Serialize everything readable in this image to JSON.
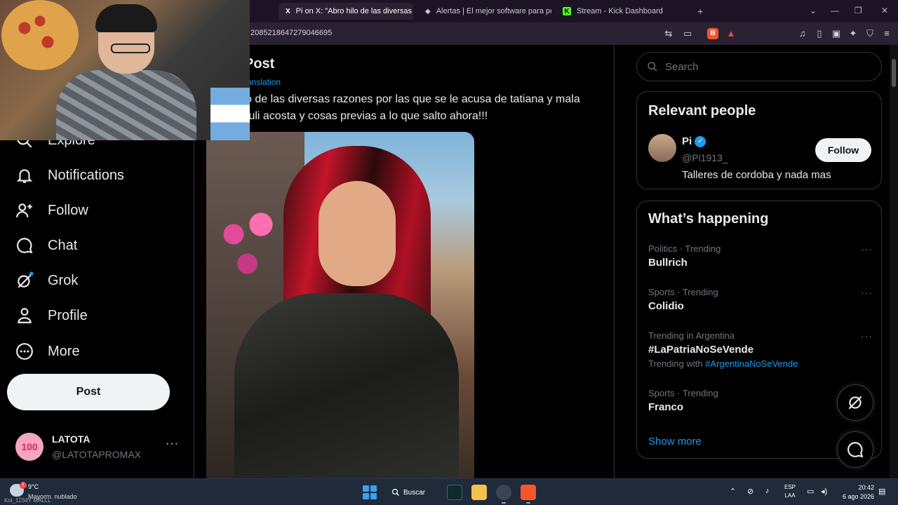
{
  "browser": {
    "tabs": [
      {
        "label": "Pi on X: \"Abro hilo de las diversas",
        "favicon": "X"
      },
      {
        "label": "Alertas | El mejor software para poten",
        "favicon": "◆"
      },
      {
        "label": "Stream - Kick Dashboard",
        "favicon": "K"
      }
    ],
    "url": "2085218647279046695",
    "new_tab": "+"
  },
  "nav": {
    "items": [
      {
        "label": "Explore",
        "icon": "search-icon"
      },
      {
        "label": "Notifications",
        "icon": "bell-icon"
      },
      {
        "label": "Follow",
        "icon": "person-plus-icon"
      },
      {
        "label": "Chat",
        "icon": "chat-bubble-icon"
      },
      {
        "label": "Grok",
        "icon": "grok-icon"
      },
      {
        "label": "Profile",
        "icon": "person-icon"
      },
      {
        "label": "More",
        "icon": "more-circle-icon"
      }
    ],
    "post_label": "Post"
  },
  "account": {
    "avatar_text": "100",
    "name": "LATOTA",
    "handle": "@LATOTAPROMAX",
    "more": "···"
  },
  "post": {
    "heading": "Post",
    "translation": "ranslation",
    "text_line1": "o de las diversas razones por las que se le acusa de tatiana y mala",
    "text_line2": "tuli acosta y cosas previas a lo que salto ahora!!!"
  },
  "search": {
    "placeholder": "Search"
  },
  "relevant": {
    "title": "Relevant people",
    "name": "Pi",
    "verified": "✓",
    "handle": "@Pi1913_",
    "bio": "Talleres de cordoba y nada mas",
    "follow_label": "Follow"
  },
  "happening": {
    "title": "What’s happening",
    "trends": [
      {
        "meta": "Politics · Trending",
        "name": "Bullrich",
        "with_prefix": "",
        "with_tag": ""
      },
      {
        "meta": "Sports · Trending",
        "name": "Colidio",
        "with_prefix": "",
        "with_tag": ""
      },
      {
        "meta": "Trending in Argentina",
        "name": "#LaPatriaNoSeVende",
        "with_prefix": "Trending with",
        "with_tag": "#ArgentinaNoSeVende"
      },
      {
        "meta": "Sports · Trending",
        "name": "Franco",
        "with_prefix": "",
        "with_tag": ""
      }
    ],
    "show_more": "Show more",
    "more": "···"
  },
  "taskbar": {
    "weather_temp": "9°C",
    "weather_desc": "Mayorm. nublado",
    "weather_badge": "1",
    "overlay_user": "Koi_1234Y MALLL",
    "search_label": "Buscar",
    "lang_line1": "ESP",
    "lang_line2": "LAA",
    "time": "20:42",
    "date": "6 ago 2026"
  },
  "colors": {
    "accent": "#1d9bf0",
    "background": "#000000",
    "border": "#2f3336",
    "chrome": "#2a2133"
  }
}
